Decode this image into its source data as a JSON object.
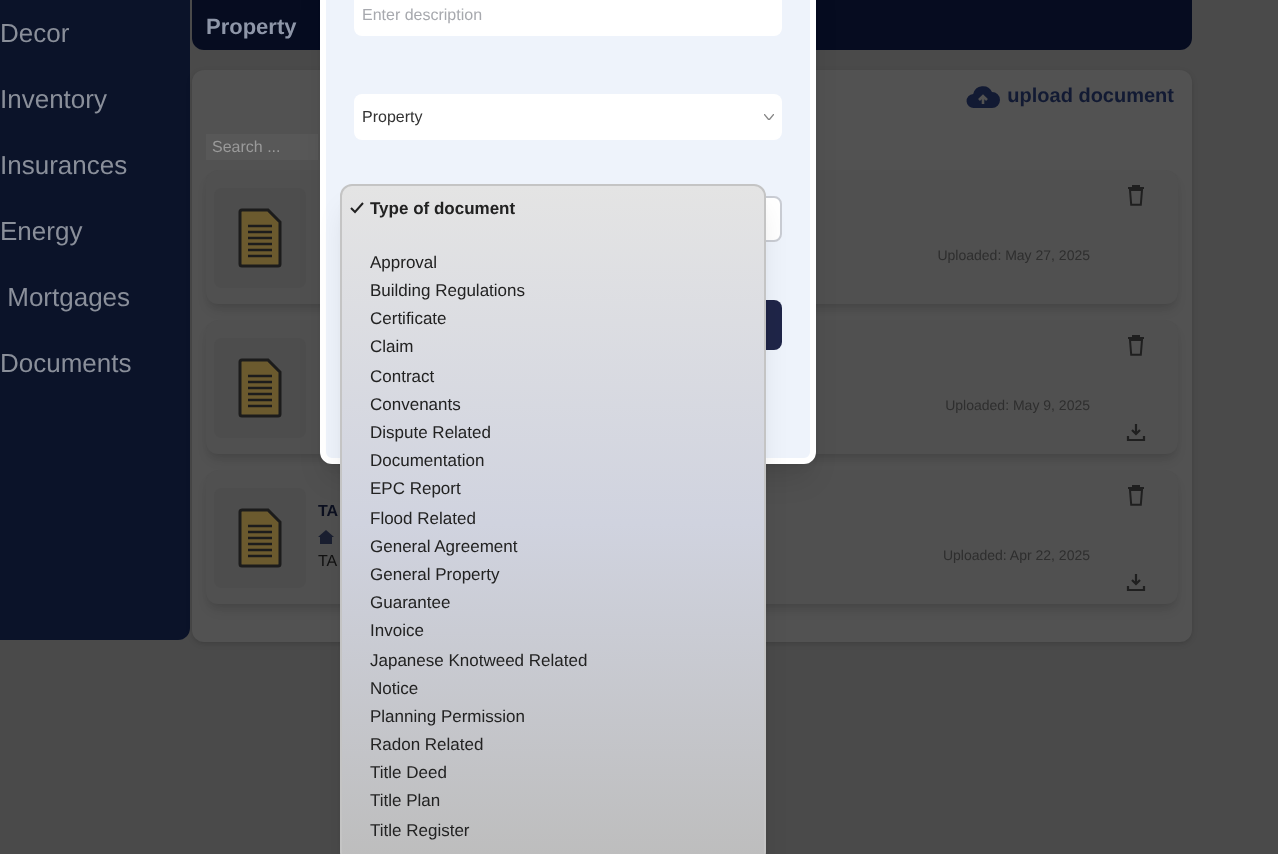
{
  "sidebar": {
    "items": [
      {
        "label": "Decor"
      },
      {
        "label": "Inventory"
      },
      {
        "label": "Insurances"
      },
      {
        "label": "Energy"
      },
      {
        "label": " Mortgages"
      },
      {
        "label": "Documents"
      }
    ]
  },
  "header": {
    "title": "Property"
  },
  "documents_panel": {
    "upload_label": "upload document",
    "search": {
      "placeholder": "Search ..."
    },
    "cards": [
      {
        "uploaded": "Uploaded: May 27, 2025",
        "download": false
      },
      {
        "uploaded": "Uploaded: May 9, 2025",
        "download": true
      },
      {
        "title": "TA",
        "subtitle": "TA",
        "uploaded": "Uploaded: Apr 22, 2025",
        "download": true
      }
    ]
  },
  "modal": {
    "description": {
      "placeholder": "Enter description"
    },
    "category_select": {
      "value": "Property"
    }
  },
  "type_dropdown": {
    "options": [
      {
        "label": "Type of document",
        "selected": true
      },
      {
        "label": "Approval",
        "selected": false
      },
      {
        "label": "Building Regulations",
        "selected": false
      },
      {
        "label": "Certificate",
        "selected": false
      },
      {
        "label": "Claim",
        "selected": false
      },
      {
        "label": "Contract",
        "selected": false
      },
      {
        "label": "Convenants",
        "selected": false
      },
      {
        "label": "Dispute Related",
        "selected": false
      },
      {
        "label": "Documentation",
        "selected": false
      },
      {
        "label": "EPC Report",
        "selected": false
      },
      {
        "label": "Flood Related",
        "selected": false
      },
      {
        "label": "General Agreement",
        "selected": false
      },
      {
        "label": "General Property",
        "selected": false
      },
      {
        "label": "Guarantee",
        "selected": false
      },
      {
        "label": "Invoice",
        "selected": false
      },
      {
        "label": "Japanese Knotweed Related",
        "selected": false
      },
      {
        "label": "Notice",
        "selected": false
      },
      {
        "label": "Planning Permission",
        "selected": false
      },
      {
        "label": "Radon Related",
        "selected": false
      },
      {
        "label": "Title Deed",
        "selected": false
      },
      {
        "label": "Title Plan",
        "selected": false
      },
      {
        "label": "Title Register",
        "selected": false
      }
    ]
  }
}
